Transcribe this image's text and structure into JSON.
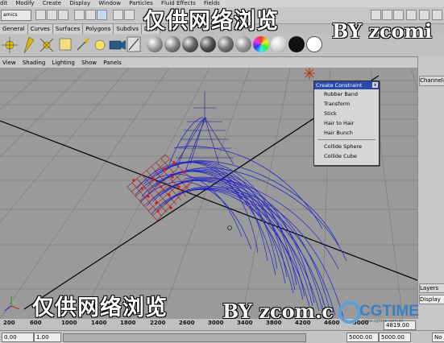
{
  "menubar": [
    "dit",
    "Modify",
    "Create",
    "Display",
    "Window",
    "Particles",
    "Fluid Effects",
    "Fields"
  ],
  "statusline": {
    "mode": "amics"
  },
  "shelf_tabs": [
    "General",
    "Curves",
    "Surfaces",
    "Polygons",
    "Subdivs",
    "Defo"
  ],
  "panel_menu": [
    "View",
    "Shading",
    "Lighting",
    "Show",
    "Panels"
  ],
  "popup": {
    "title": "Create Constraint",
    "close": "x",
    "items": [
      "Rubber Band",
      "Transform",
      "Stick",
      "Hair to Hair",
      "Hair Bunch"
    ],
    "items2": [
      "Collide Sphere",
      "Collide Cube"
    ]
  },
  "right": {
    "channels": "Channels",
    "layers": "Layers",
    "display": "Display"
  },
  "timeline": {
    "ticks": [
      "200",
      "600",
      "1000",
      "1400",
      "1800",
      "2200",
      "2600",
      "3000",
      "3400",
      "3800",
      "4200",
      "4600",
      "5000"
    ],
    "current": "4819.00"
  },
  "range": {
    "start": "0.00",
    "start2": "1.00",
    "end": "5000.00",
    "end2": "5000.00",
    "no": "No"
  },
  "watermarks": {
    "cn_top": "仅供网络浏览",
    "by_top": "BY zcomi",
    "cn_bottom": "仅供网络浏览",
    "by_bottom": "BY zcom.c",
    "logo": "CGTIME",
    "site": "www.cgtime.com.cn"
  },
  "colors": {
    "viewport": "#9a9a9a",
    "grid": "#7e7e7e",
    "hair": "#2020c8",
    "popup_title": "#2a4aa8"
  }
}
